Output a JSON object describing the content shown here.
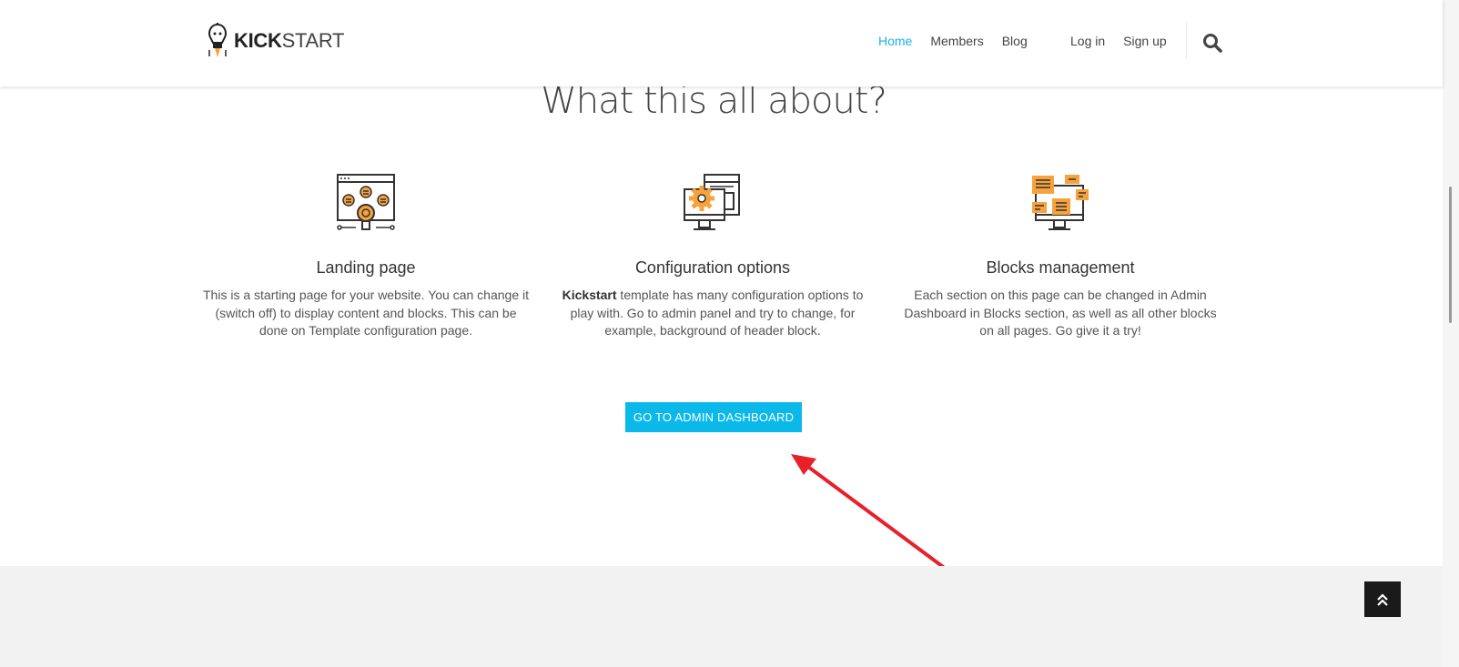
{
  "header": {
    "logo_bold": "KICK",
    "logo_rest": "START",
    "nav": [
      {
        "label": "Home",
        "active": true
      },
      {
        "label": "Members",
        "active": false
      },
      {
        "label": "Blog",
        "active": false
      }
    ],
    "auth": [
      {
        "label": "Log in"
      },
      {
        "label": "Sign up"
      }
    ],
    "search_icon": "search-icon"
  },
  "main": {
    "title": "What this all about?",
    "features": [
      {
        "icon": "lightbulb-browser-icon",
        "title": "Landing page",
        "text": "This is a starting page for your website. You can change it (switch off) to display content and blocks. This can be done on Template configuration page."
      },
      {
        "icon": "config-gear-monitor-icon",
        "title": "Configuration options",
        "text_bold": "Kickstart",
        "text": " template has many configuration options to play with. Go to admin panel and try to change, for example, background of header block."
      },
      {
        "icon": "blocks-monitor-icon",
        "title": "Blocks management",
        "text": "Each section on this page can be changed in Admin Dashboard in Blocks section, as well as all other blocks on all pages. Go give it a try!"
      }
    ],
    "cta_label": "GO TO ADMIN DASHBOARD"
  },
  "annotation": {
    "type": "red-arrow",
    "color": "#e8202a"
  },
  "colors": {
    "accent": "#0bb8ea",
    "icon_orange": "#f7a23c",
    "footer_bg": "#f2f2f2"
  },
  "back_to_top_icon": "double-chevron-up-icon"
}
